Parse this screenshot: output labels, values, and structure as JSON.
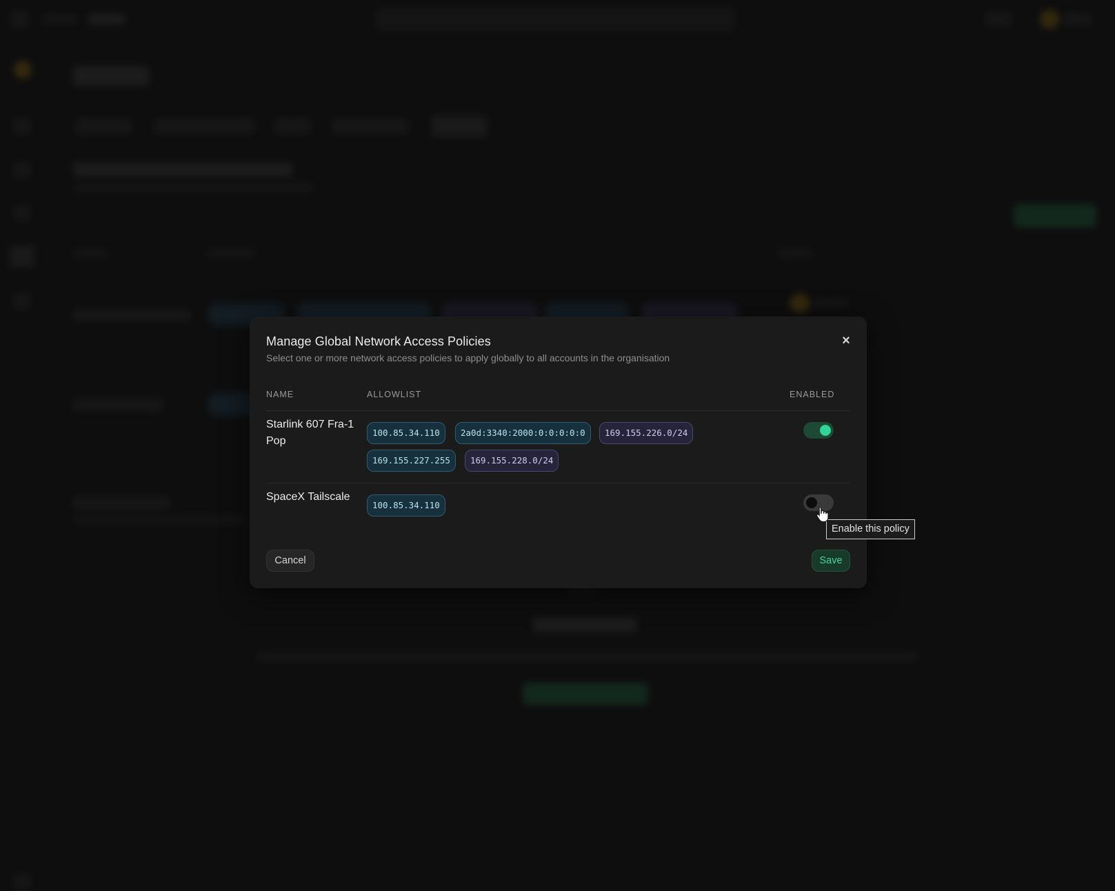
{
  "modal": {
    "title": "Manage Global Network Access Policies",
    "subtitle": "Select one or more network access policies to apply globally to all accounts in the organisation",
    "close_icon": "×",
    "columns": {
      "name": "NAME",
      "allowlist": "ALLOWLIST",
      "enabled": "ENABLED"
    },
    "policies": [
      {
        "name": "Starlink 607 Fra-1 Pop",
        "enabled": true,
        "allowlist": [
          {
            "value": "100.85.34.110",
            "color": "teal"
          },
          {
            "value": "2a0d:3340:2000:0:0:0:0:0",
            "color": "teal"
          },
          {
            "value": "169.155.226.0/24",
            "color": "purple"
          },
          {
            "value": "169.155.227.255",
            "color": "teal"
          },
          {
            "value": "169.155.228.0/24",
            "color": "purple"
          }
        ]
      },
      {
        "name": "SpaceX Tailscale",
        "enabled": false,
        "allowlist": [
          {
            "value": "100.85.34.110",
            "color": "teal"
          }
        ]
      }
    ],
    "cancel_label": "Cancel",
    "save_label": "Save"
  },
  "tooltip": {
    "text": "Enable this policy"
  },
  "colors": {
    "accent_green": "#34d399",
    "chip_teal_bg": "#17303d",
    "chip_purple_bg": "#25243a",
    "modal_bg": "#1b1b1b",
    "page_bg": "#121212"
  },
  "icons": {
    "close": "close-icon",
    "cursor": "pointer-hand-icon"
  }
}
